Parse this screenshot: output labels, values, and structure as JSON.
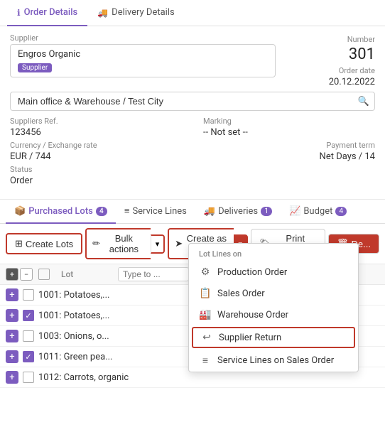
{
  "tabs": {
    "top": [
      {
        "id": "order-details",
        "label": "Order Details",
        "icon": "ℹ",
        "active": true
      },
      {
        "id": "delivery-details",
        "label": "Delivery Details",
        "icon": "🚚",
        "active": false
      }
    ]
  },
  "order": {
    "supplier_label": "Supplier",
    "supplier_name": "Engros Organic",
    "supplier_badge": "Supplier",
    "warehouse": "Main office & Warehouse / Test City",
    "warehouse_placeholder": "Main office & Warehouse / Test City",
    "number_label": "Number",
    "number_value": "301",
    "order_date_label": "Order date",
    "order_date_value": "20.12.2022",
    "suppliers_ref_label": "Suppliers Ref.",
    "suppliers_ref_value": "123456",
    "marking_label": "Marking",
    "marking_value": "-- Not set --",
    "currency_label": "Currency / Exchange rate",
    "currency_value": "EUR / 744",
    "payment_term_label": "Payment term",
    "payment_term_value": "Net Days / 14",
    "status_label": "Status",
    "status_value": "Order"
  },
  "section_tabs": [
    {
      "id": "purchased-lots",
      "label": "Purchased Lots",
      "badge": "4",
      "active": true,
      "icon": "📦"
    },
    {
      "id": "service-lines",
      "label": "Service Lines",
      "badge": "",
      "active": false,
      "icon": "≡"
    },
    {
      "id": "deliveries",
      "label": "Deliveries",
      "badge": "1",
      "active": false,
      "icon": "🚚"
    },
    {
      "id": "budget",
      "label": "Budget",
      "badge": "4",
      "active": false,
      "icon": "📈"
    }
  ],
  "toolbar": {
    "create_lots_label": "Create Lots",
    "bulk_actions_label": "Bulk actions",
    "create_as_label": "Create as ...",
    "print_labels_label": "Print Labels",
    "delete_label": "De..."
  },
  "table_header": {
    "lot_col": "Lot",
    "search_placeholder": "Type to ..."
  },
  "rows": [
    {
      "id": "r1",
      "checked": false,
      "lot": "1001: Potatoes,..."
    },
    {
      "id": "r2",
      "checked": true,
      "lot": "1001: Potatoes,..."
    },
    {
      "id": "r3",
      "checked": false,
      "lot": "1003: Onions, o..."
    },
    {
      "id": "r4",
      "checked": true,
      "lot": "1011: Green pea..."
    },
    {
      "id": "r5",
      "checked": false,
      "lot": "1012: Carrots, organic"
    }
  ],
  "dropdown": {
    "section_label": "Lot Lines on",
    "items": [
      {
        "id": "production-order",
        "icon": "⚙",
        "label": "Production Order"
      },
      {
        "id": "sales-order",
        "icon": "📋",
        "label": "Sales Order"
      },
      {
        "id": "warehouse-order",
        "icon": "🏭",
        "label": "Warehouse Order"
      },
      {
        "id": "supplier-return",
        "icon": "↩",
        "label": "Supplier Return",
        "highlighted": true
      },
      {
        "id": "service-lines-sales",
        "icon": "≡",
        "label": "Service Lines on Sales Order"
      }
    ]
  }
}
